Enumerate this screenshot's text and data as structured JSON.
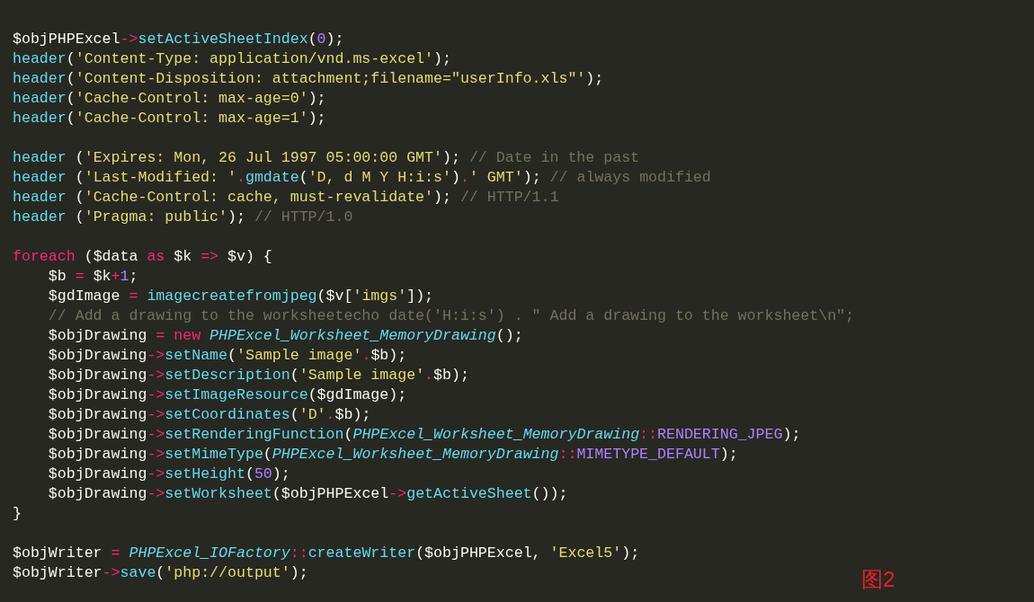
{
  "blocks": [
    {
      "lines": [
        [
          {
            "kind": "plain",
            "text": "$objPHPExcel"
          },
          {
            "kind": "operator",
            "text": "->"
          },
          {
            "kind": "function",
            "text": "setActiveSheetIndex"
          },
          {
            "kind": "plain",
            "text": "("
          },
          {
            "kind": "number",
            "text": "0"
          },
          {
            "kind": "plain",
            "text": ");"
          }
        ],
        [
          {
            "kind": "function",
            "text": "header"
          },
          {
            "kind": "plain",
            "text": "("
          },
          {
            "kind": "string",
            "text": "'Content-Type: application/vnd.ms-excel'"
          },
          {
            "kind": "plain",
            "text": ");"
          }
        ],
        [
          {
            "kind": "function",
            "text": "header"
          },
          {
            "kind": "plain",
            "text": "("
          },
          {
            "kind": "string",
            "text": "'Content-Disposition: attachment;filename=\"userInfo.xls\"'"
          },
          {
            "kind": "plain",
            "text": ");"
          }
        ],
        [
          {
            "kind": "function",
            "text": "header"
          },
          {
            "kind": "plain",
            "text": "("
          },
          {
            "kind": "string",
            "text": "'Cache-Control: max-age=0'"
          },
          {
            "kind": "plain",
            "text": ");"
          }
        ],
        [
          {
            "kind": "function",
            "text": "header"
          },
          {
            "kind": "plain",
            "text": "("
          },
          {
            "kind": "string",
            "text": "'Cache-Control: max-age=1'"
          },
          {
            "kind": "plain",
            "text": ");"
          }
        ]
      ]
    },
    {
      "lines": [
        [
          {
            "kind": "function",
            "text": "header"
          },
          {
            "kind": "plain",
            "text": " ("
          },
          {
            "kind": "string",
            "text": "'Expires: Mon, 26 Jul 1997 05:00:00 GMT'"
          },
          {
            "kind": "plain",
            "text": "); "
          },
          {
            "kind": "comment",
            "text": "// Date in the past"
          }
        ],
        [
          {
            "kind": "function",
            "text": "header"
          },
          {
            "kind": "plain",
            "text": " ("
          },
          {
            "kind": "string",
            "text": "'Last-Modified: '"
          },
          {
            "kind": "operator",
            "text": "."
          },
          {
            "kind": "function",
            "text": "gmdate"
          },
          {
            "kind": "plain",
            "text": "("
          },
          {
            "kind": "string",
            "text": "'D, d M Y H:i:s'"
          },
          {
            "kind": "plain",
            "text": ")"
          },
          {
            "kind": "operator",
            "text": "."
          },
          {
            "kind": "string",
            "text": "' GMT'"
          },
          {
            "kind": "plain",
            "text": "); "
          },
          {
            "kind": "comment",
            "text": "// always modified"
          }
        ],
        [
          {
            "kind": "function",
            "text": "header"
          },
          {
            "kind": "plain",
            "text": " ("
          },
          {
            "kind": "string",
            "text": "'Cache-Control: cache, must-revalidate'"
          },
          {
            "kind": "plain",
            "text": "); "
          },
          {
            "kind": "comment",
            "text": "// HTTP/1.1"
          }
        ],
        [
          {
            "kind": "function",
            "text": "header"
          },
          {
            "kind": "plain",
            "text": " ("
          },
          {
            "kind": "string",
            "text": "'Pragma: public'"
          },
          {
            "kind": "plain",
            "text": "); "
          },
          {
            "kind": "comment",
            "text": "// HTTP/1.0"
          }
        ]
      ]
    },
    {
      "lines": [
        [
          {
            "kind": "operator",
            "text": "foreach"
          },
          {
            "kind": "plain",
            "text": " ($data "
          },
          {
            "kind": "operator",
            "text": "as"
          },
          {
            "kind": "plain",
            "text": " $k "
          },
          {
            "kind": "operator",
            "text": "=>"
          },
          {
            "kind": "plain",
            "text": " $v) {"
          }
        ],
        [
          {
            "kind": "plain",
            "text": "    $b "
          },
          {
            "kind": "operator",
            "text": "="
          },
          {
            "kind": "plain",
            "text": " $k"
          },
          {
            "kind": "operator",
            "text": "+"
          },
          {
            "kind": "number",
            "text": "1"
          },
          {
            "kind": "plain",
            "text": ";"
          }
        ],
        [
          {
            "kind": "plain",
            "text": "    $gdImage "
          },
          {
            "kind": "operator",
            "text": "= "
          },
          {
            "kind": "function",
            "text": "imagecreatefromjpeg"
          },
          {
            "kind": "plain",
            "text": "($v["
          },
          {
            "kind": "string",
            "text": "'imgs'"
          },
          {
            "kind": "plain",
            "text": "]);"
          }
        ],
        [
          {
            "kind": "comment",
            "text": "    // Add a drawing to the worksheetecho date('H:i:s') . \" Add a drawing to the worksheet\\n\";"
          }
        ],
        [
          {
            "kind": "plain",
            "text": "    $objDrawing "
          },
          {
            "kind": "operator",
            "text": "= new "
          },
          {
            "kind": "class",
            "text": "PHPExcel_Worksheet_MemoryDrawing"
          },
          {
            "kind": "plain",
            "text": "();"
          }
        ],
        [
          {
            "kind": "plain",
            "text": "    $objDrawing"
          },
          {
            "kind": "operator",
            "text": "->"
          },
          {
            "kind": "function",
            "text": "setName"
          },
          {
            "kind": "plain",
            "text": "("
          },
          {
            "kind": "string",
            "text": "'Sample image'"
          },
          {
            "kind": "operator",
            "text": "."
          },
          {
            "kind": "plain",
            "text": "$b);"
          }
        ],
        [
          {
            "kind": "plain",
            "text": "    $objDrawing"
          },
          {
            "kind": "operator",
            "text": "->"
          },
          {
            "kind": "function",
            "text": "setDescription"
          },
          {
            "kind": "plain",
            "text": "("
          },
          {
            "kind": "string",
            "text": "'Sample image'"
          },
          {
            "kind": "operator",
            "text": "."
          },
          {
            "kind": "plain",
            "text": "$b);"
          }
        ],
        [
          {
            "kind": "plain",
            "text": "    $objDrawing"
          },
          {
            "kind": "operator",
            "text": "->"
          },
          {
            "kind": "function",
            "text": "setImageResource"
          },
          {
            "kind": "plain",
            "text": "($gdImage);"
          }
        ],
        [
          {
            "kind": "plain",
            "text": "    $objDrawing"
          },
          {
            "kind": "operator",
            "text": "->"
          },
          {
            "kind": "function",
            "text": "setCoordinates"
          },
          {
            "kind": "plain",
            "text": "("
          },
          {
            "kind": "string",
            "text": "'D'"
          },
          {
            "kind": "operator",
            "text": "."
          },
          {
            "kind": "plain",
            "text": "$b);"
          }
        ],
        [
          {
            "kind": "plain",
            "text": "    $objDrawing"
          },
          {
            "kind": "operator",
            "text": "->"
          },
          {
            "kind": "function",
            "text": "setRenderingFunction"
          },
          {
            "kind": "plain",
            "text": "("
          },
          {
            "kind": "class",
            "text": "PHPExcel_Worksheet_MemoryDrawing"
          },
          {
            "kind": "operator",
            "text": "::"
          },
          {
            "kind": "number",
            "text": "RENDERING_JPEG"
          },
          {
            "kind": "plain",
            "text": ");"
          }
        ],
        [
          {
            "kind": "plain",
            "text": "    $objDrawing"
          },
          {
            "kind": "operator",
            "text": "->"
          },
          {
            "kind": "function",
            "text": "setMimeType"
          },
          {
            "kind": "plain",
            "text": "("
          },
          {
            "kind": "class",
            "text": "PHPExcel_Worksheet_MemoryDrawing"
          },
          {
            "kind": "operator",
            "text": "::"
          },
          {
            "kind": "number",
            "text": "MIMETYPE_DEFAULT"
          },
          {
            "kind": "plain",
            "text": ");"
          }
        ],
        [
          {
            "kind": "plain",
            "text": "    $objDrawing"
          },
          {
            "kind": "operator",
            "text": "->"
          },
          {
            "kind": "function",
            "text": "setHeight"
          },
          {
            "kind": "plain",
            "text": "("
          },
          {
            "kind": "number",
            "text": "50"
          },
          {
            "kind": "plain",
            "text": ");"
          }
        ],
        [
          {
            "kind": "plain",
            "text": "    $objDrawing"
          },
          {
            "kind": "operator",
            "text": "->"
          },
          {
            "kind": "function",
            "text": "setWorksheet"
          },
          {
            "kind": "plain",
            "text": "($objPHPExcel"
          },
          {
            "kind": "operator",
            "text": "->"
          },
          {
            "kind": "function",
            "text": "getActiveSheet"
          },
          {
            "kind": "plain",
            "text": "());"
          }
        ],
        [
          {
            "kind": "plain",
            "text": "}"
          }
        ]
      ]
    },
    {
      "lines": [
        [
          {
            "kind": "plain",
            "text": "$objWriter "
          },
          {
            "kind": "operator",
            "text": "= "
          },
          {
            "kind": "class",
            "text": "PHPExcel_IOFactory"
          },
          {
            "kind": "operator",
            "text": "::"
          },
          {
            "kind": "function",
            "text": "createWriter"
          },
          {
            "kind": "plain",
            "text": "($objPHPExcel, "
          },
          {
            "kind": "string",
            "text": "'Excel5'"
          },
          {
            "kind": "plain",
            "text": ");"
          }
        ],
        [
          {
            "kind": "plain",
            "text": "$objWriter"
          },
          {
            "kind": "operator",
            "text": "->"
          },
          {
            "kind": "function",
            "text": "save"
          },
          {
            "kind": "plain",
            "text": "("
          },
          {
            "kind": "string",
            "text": "'php://output'"
          },
          {
            "kind": "plain",
            "text": ");"
          }
        ]
      ]
    }
  ],
  "figure_label": "图2"
}
